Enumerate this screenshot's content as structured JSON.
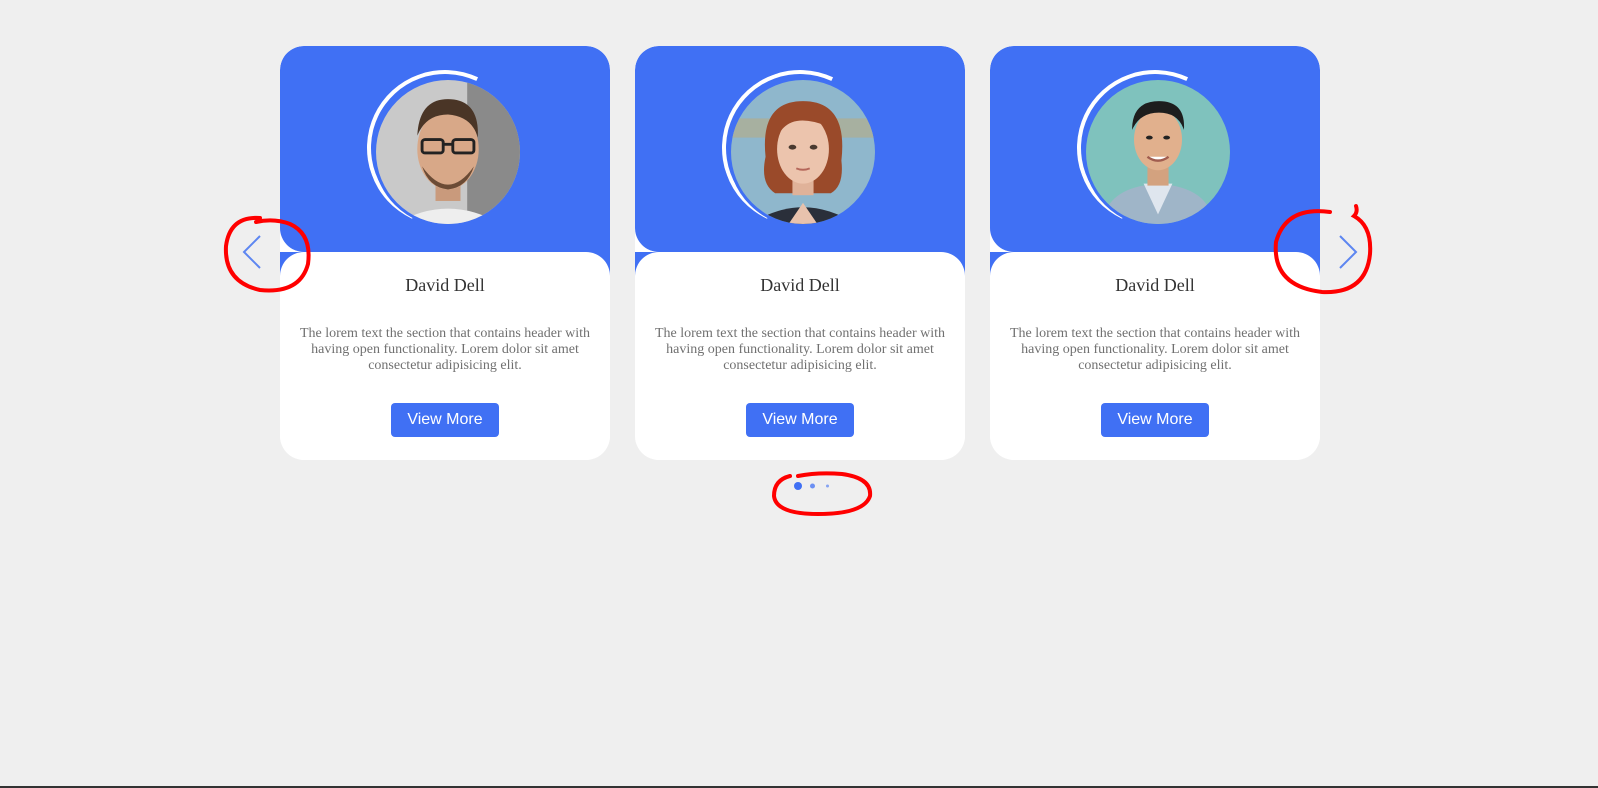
{
  "cards": [
    {
      "name": "David Dell",
      "description": "The lorem text the section that contains header with having open functionality. Lorem dolor sit amet consectetur adipisicing elit.",
      "button_label": "View More",
      "avatar_icon": "portrait-man-glasses"
    },
    {
      "name": "David Dell",
      "description": "The lorem text the section that contains header with having open functionality. Lorem dolor sit amet consectetur adipisicing elit.",
      "button_label": "View More",
      "avatar_icon": "portrait-woman-red-hair"
    },
    {
      "name": "David Dell",
      "description": "The lorem text the section that contains header with having open functionality. Lorem dolor sit amet consectetur adipisicing elit.",
      "button_label": "View More",
      "avatar_icon": "portrait-man-teal-wall"
    }
  ],
  "navigation": {
    "prev_icon": "chevron-left-icon",
    "next_icon": "chevron-right-icon"
  },
  "pagination": {
    "total": 3,
    "active": 1
  },
  "colors": {
    "accent": "#4070f4",
    "background": "#efefef",
    "annotation": "#ff0000"
  }
}
